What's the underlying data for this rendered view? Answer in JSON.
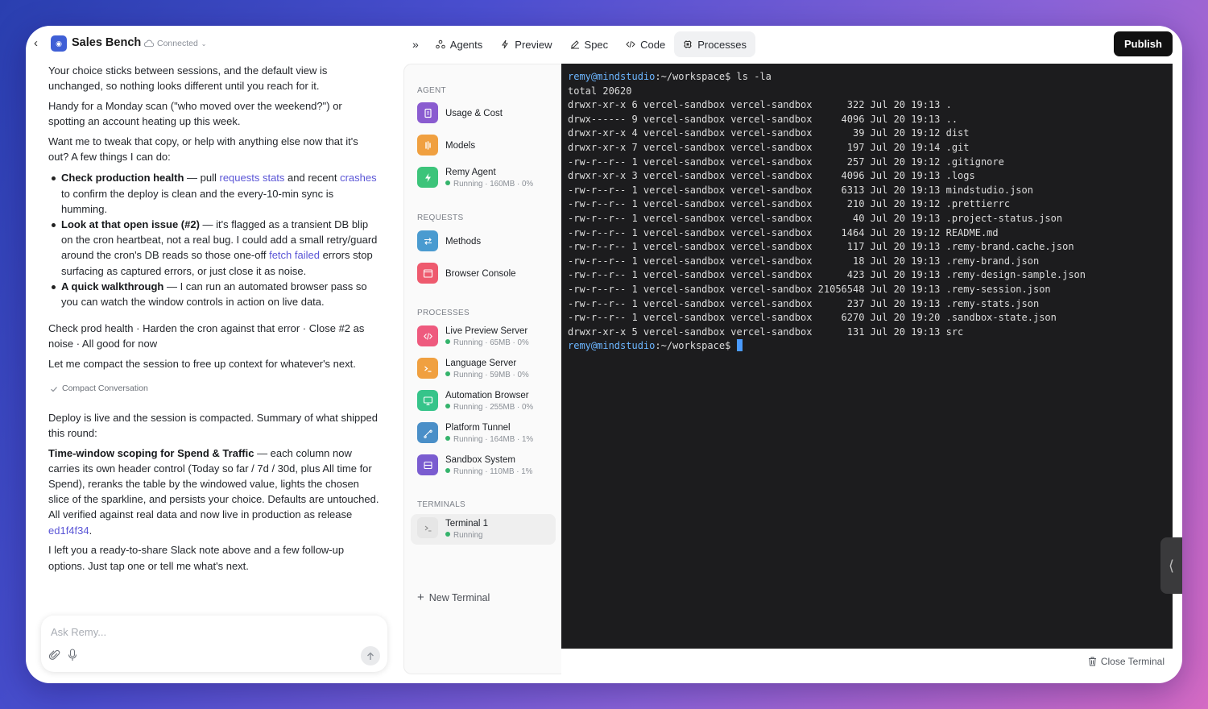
{
  "app": {
    "title": "Sales Bench",
    "status": "Connected",
    "logo_text": "◉"
  },
  "tabs": [
    {
      "label": "Agents",
      "icon": "agents-icon"
    },
    {
      "label": "Preview",
      "icon": "preview-icon"
    },
    {
      "label": "Spec",
      "icon": "spec-icon"
    },
    {
      "label": "Code",
      "icon": "code-icon"
    },
    {
      "label": "Processes",
      "icon": "processes-icon"
    }
  ],
  "publish_label": "Publish",
  "chat": {
    "p1": "Your choice sticks between sessions, and the default view is unchanged, so nothing looks different until you reach for it.",
    "p2": "Handy for a Monday scan (\"who moved over the weekend?\") or spotting an account heating up this week.",
    "p3": "Want me to tweak that copy, or help with anything else now that it's out? A few things I can do:",
    "b1_bold": "Check production health",
    "b1_a": " — pull ",
    "b1_link1": "requests stats",
    "b1_b": " and recent ",
    "b1_link2": "crashes",
    "b1_c": " to confirm the deploy is clean and the every-10-min sync is humming.",
    "b2_bold": "Look at that open issue (#2)",
    "b2_a": " — it's flagged as a transient DB blip on the cron heartbeat, not a real bug. I could add a small retry/guard around the cron's DB reads so those one-off ",
    "b2_link": "fetch failed",
    "b2_b": " errors stop surfacing as captured errors, or just close it as noise.",
    "b3_bold": "A quick walkthrough",
    "b3_a": " — I can run an automated browser pass so you can watch the window controls in action on live data.",
    "p4": "Check prod health · Harden the cron against that error · Close #2 as noise · All good for now",
    "p5": "Let me compact the session to free up context for whatever's next.",
    "compact_label": "Compact Conversation",
    "p6": "Deploy is live and the session is compacted. Summary of what shipped this round:",
    "p7_bold": "Time-window scoping for Spend & Traffic",
    "p7_a": " — each column now carries its own header control (Today so far / 7d / 30d, plus All time for Spend), reranks the table by the windowed value, lights the chosen slice of the sparkline, and persists your choice. Defaults are untouched. All verified against real data and now live in production as release ",
    "p7_link": "ed1f4f34",
    "p7_b": ".",
    "p8": "I left you a ready-to-share Slack note above and a few follow-up options. Just tap one or tell me what's next.",
    "input_placeholder": "Ask Remy..."
  },
  "panel": {
    "sections": {
      "agent": "AGENT",
      "requests": "REQUESTS",
      "processes": "PROCESSES",
      "terminals": "TERMINALS"
    },
    "agent_items": [
      {
        "name": "Usage & Cost",
        "status": "",
        "color": "#8a5cd0",
        "icon": "usage-icon"
      },
      {
        "name": "Models",
        "status": "",
        "color": "#f0a040",
        "icon": "models-icon"
      },
      {
        "name": "Remy Agent",
        "status": "Running · 160MB · 0%",
        "color": "#3cc47a",
        "icon": "agent-bolt-icon"
      }
    ],
    "request_items": [
      {
        "name": "Methods",
        "status": "",
        "color": "#4a9bd0",
        "icon": "methods-icon"
      },
      {
        "name": "Browser Console",
        "status": "",
        "color": "#ee5a6e",
        "icon": "console-icon"
      }
    ],
    "process_items": [
      {
        "name": "Live Preview Server",
        "status": "Running · 65MB · 0%",
        "color": "#ee5a7e",
        "icon": "code-brackets-icon"
      },
      {
        "name": "Language Server",
        "status": "Running · 59MB · 0%",
        "color": "#f0a040",
        "icon": "prompt-icon"
      },
      {
        "name": "Automation Browser",
        "status": "Running · 255MB · 0%",
        "color": "#36c48a",
        "icon": "monitor-icon"
      },
      {
        "name": "Platform Tunnel",
        "status": "Running · 164MB · 1%",
        "color": "#4a8fc8",
        "icon": "tunnel-icon"
      },
      {
        "name": "Sandbox System",
        "status": "Running · 110MB · 1%",
        "color": "#7a5cd0",
        "icon": "sandbox-icon"
      }
    ],
    "terminal_items": [
      {
        "name": "Terminal 1",
        "status": "Running",
        "color": "#e8e8e8",
        "icon": "terminal-icon"
      }
    ],
    "new_terminal": "New Terminal"
  },
  "terminal": {
    "prompt_user": "remy@mindstudio",
    "prompt_path": ":~/workspace$",
    "command": " ls -la",
    "lines": [
      "total 20620",
      "drwxr-xr-x 6 vercel-sandbox vercel-sandbox      322 Jul 20 19:13 .",
      "drwx------ 9 vercel-sandbox vercel-sandbox     4096 Jul 20 19:13 ..",
      "drwxr-xr-x 4 vercel-sandbox vercel-sandbox       39 Jul 20 19:12 dist",
      "drwxr-xr-x 7 vercel-sandbox vercel-sandbox      197 Jul 20 19:14 .git",
      "-rw-r--r-- 1 vercel-sandbox vercel-sandbox      257 Jul 20 19:12 .gitignore",
      "drwxr-xr-x 3 vercel-sandbox vercel-sandbox     4096 Jul 20 19:13 .logs",
      "-rw-r--r-- 1 vercel-sandbox vercel-sandbox     6313 Jul 20 19:13 mindstudio.json",
      "-rw-r--r-- 1 vercel-sandbox vercel-sandbox      210 Jul 20 19:12 .prettierrc",
      "-rw-r--r-- 1 vercel-sandbox vercel-sandbox       40 Jul 20 19:13 .project-status.json",
      "-rw-r--r-- 1 vercel-sandbox vercel-sandbox     1464 Jul 20 19:12 README.md",
      "-rw-r--r-- 1 vercel-sandbox vercel-sandbox      117 Jul 20 19:13 .remy-brand.cache.json",
      "-rw-r--r-- 1 vercel-sandbox vercel-sandbox       18 Jul 20 19:13 .remy-brand.json",
      "-rw-r--r-- 1 vercel-sandbox vercel-sandbox      423 Jul 20 19:13 .remy-design-sample.json",
      "-rw-r--r-- 1 vercel-sandbox vercel-sandbox 21056548 Jul 20 19:13 .remy-session.json",
      "-rw-r--r-- 1 vercel-sandbox vercel-sandbox      237 Jul 20 19:13 .remy-stats.json",
      "-rw-r--r-- 1 vercel-sandbox vercel-sandbox     6270 Jul 20 19:20 .sandbox-state.json",
      "drwxr-xr-x 5 vercel-sandbox vercel-sandbox      131 Jul 20 19:13 src"
    ],
    "close_label": "Close Terminal"
  }
}
